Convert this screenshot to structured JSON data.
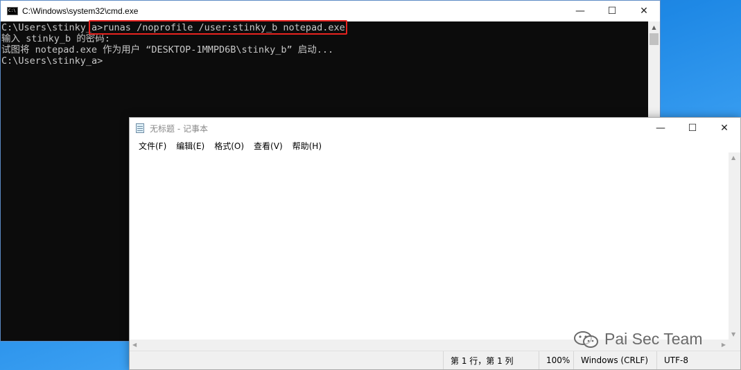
{
  "cmd": {
    "title": "C:\\Windows\\system32\\cmd.exe",
    "lines": [
      "C:\\Users\\stinky_a>runas /noprofile /user:stinky_b notepad.exe",
      "输入 stinky_b 的密码:",
      "试图将 notepad.exe 作为用户 “DESKTOP-1MMPD6B\\stinky_b” 启动...",
      "",
      "C:\\Users\\stinky_a>"
    ],
    "controls": {
      "minimize": "—",
      "maximize": "☐",
      "close": "✕"
    }
  },
  "notepad": {
    "title": "无标题 - 记事本",
    "menu": [
      "文件(F)",
      "编辑(E)",
      "格式(O)",
      "查看(V)",
      "帮助(H)"
    ],
    "content": "",
    "status": {
      "position": "第 1 行，第 1 列",
      "zoom": "100%",
      "line_ending": "Windows (CRLF)",
      "encoding": "UTF-8"
    },
    "controls": {
      "minimize": "—",
      "maximize": "☐",
      "close": "✕"
    }
  },
  "watermark": {
    "text": "Pai Sec Team"
  },
  "colors": {
    "highlight": "#e8231f",
    "console_bg": "#0c0c0c",
    "console_text": "#c8c8c8"
  }
}
